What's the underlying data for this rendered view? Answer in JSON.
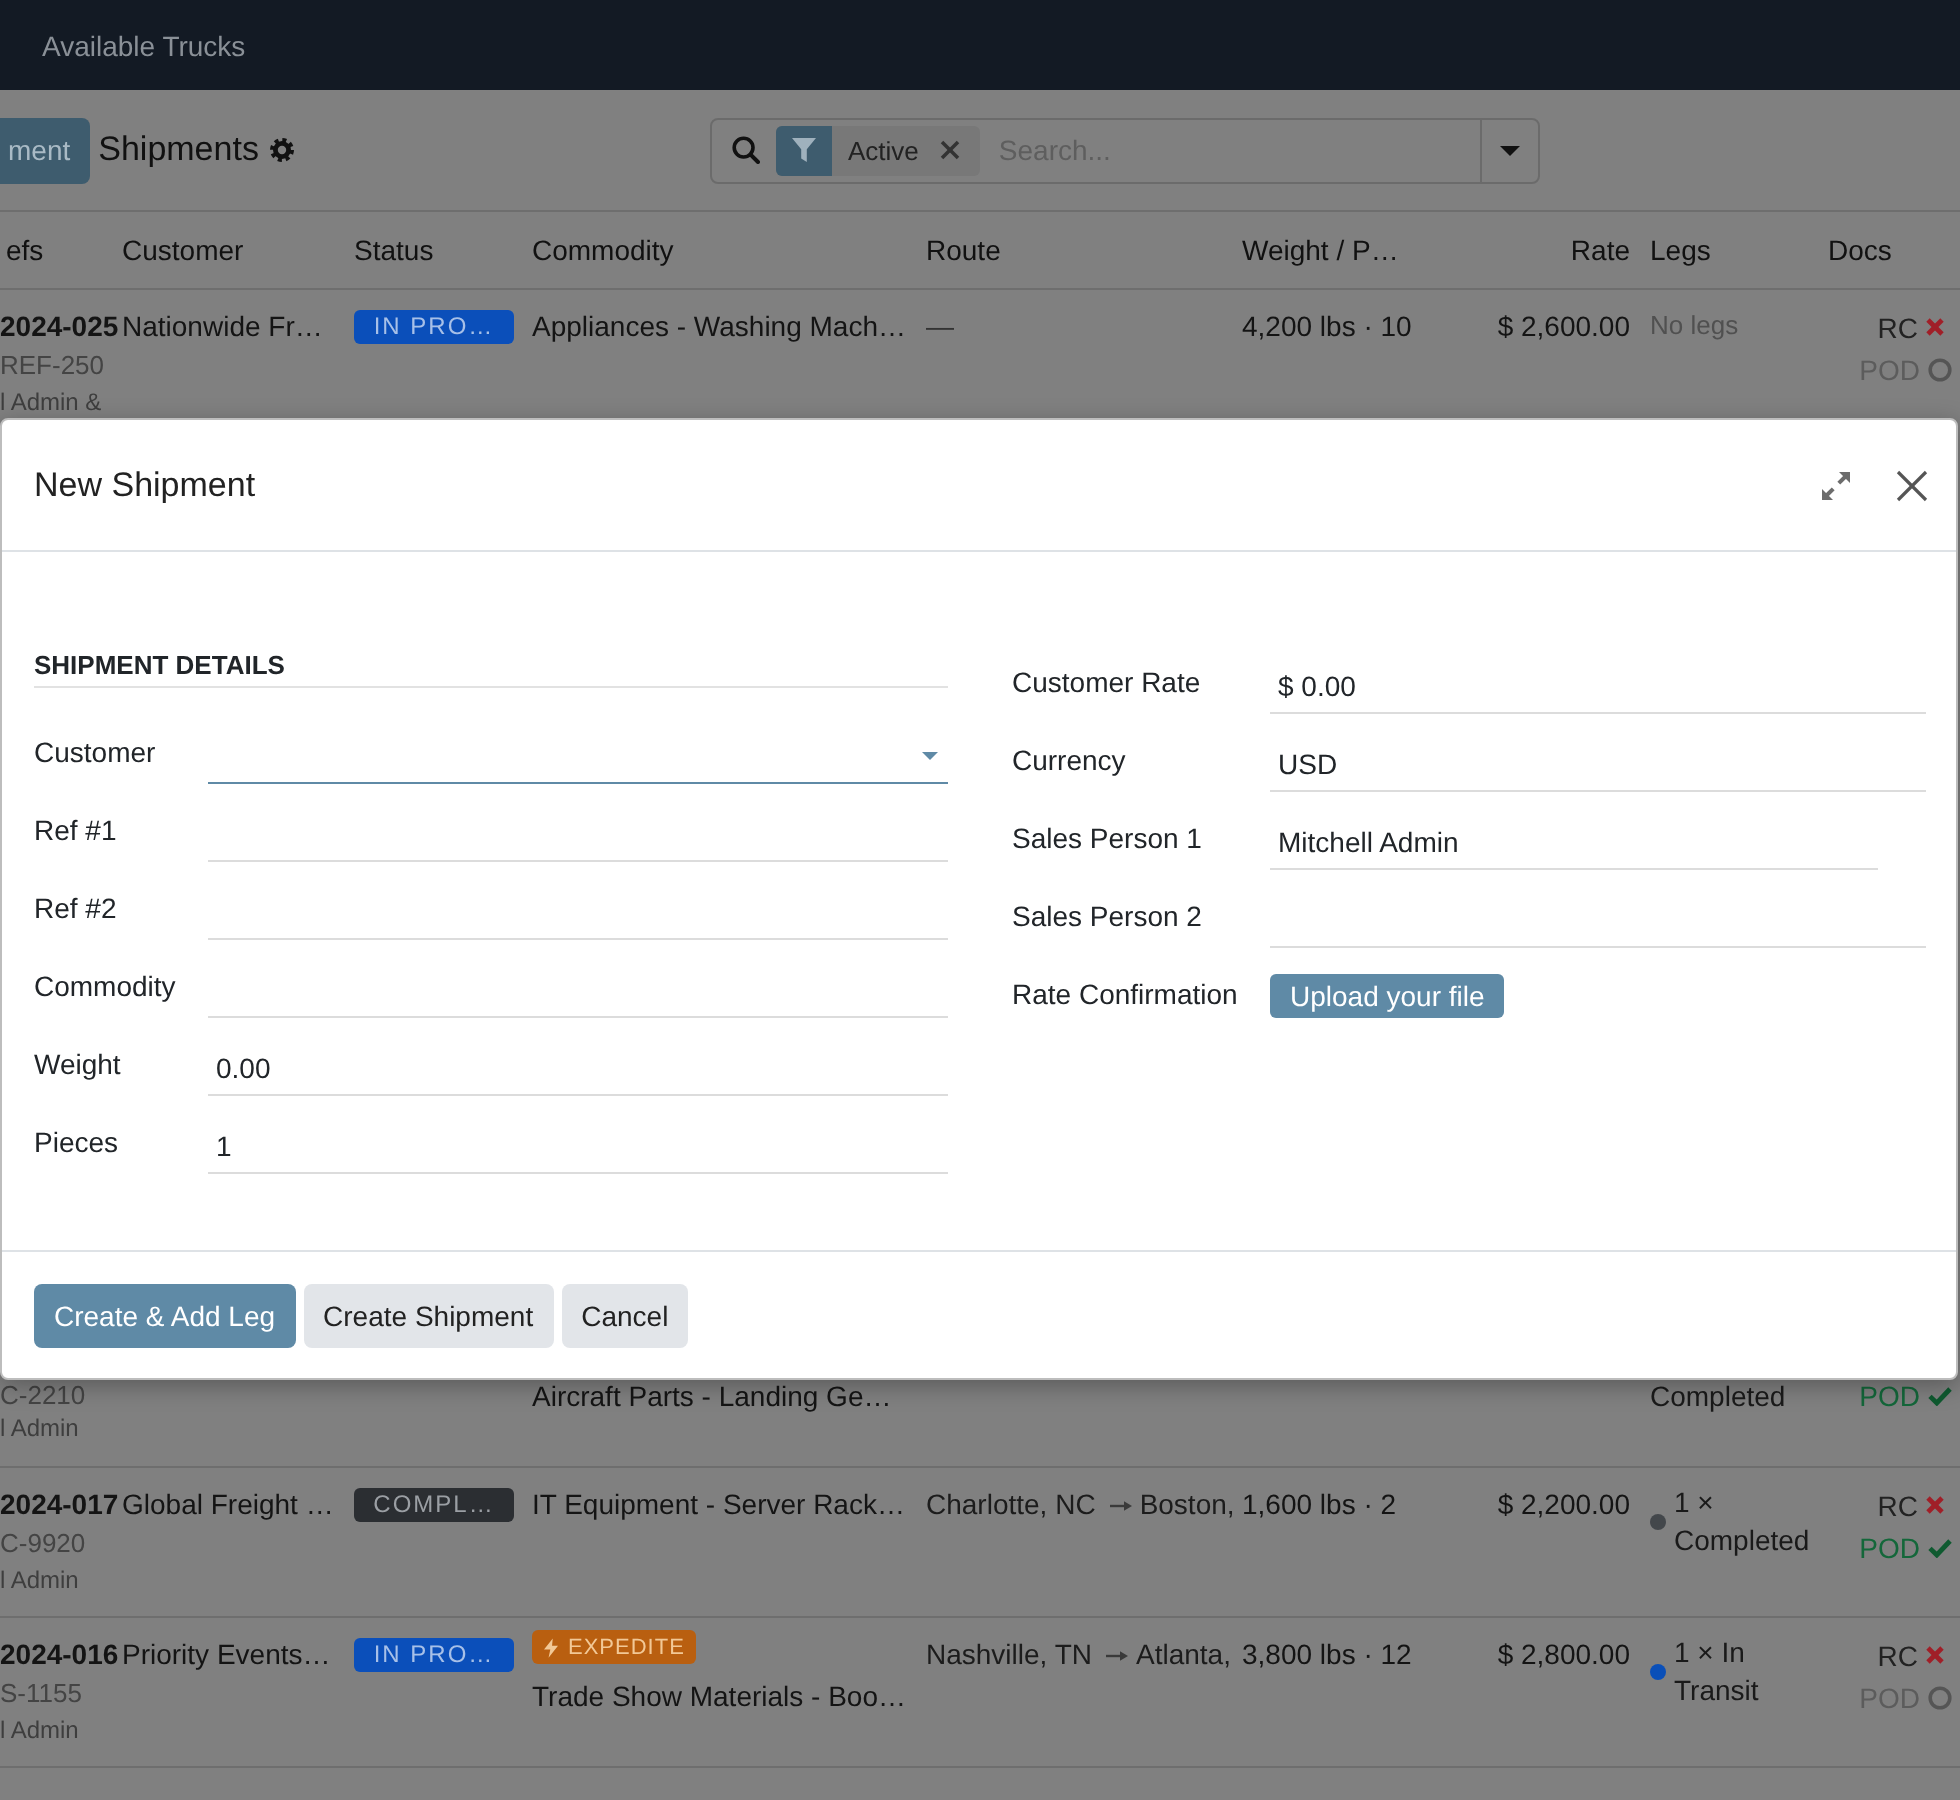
{
  "navbar": {
    "items": [
      {
        "label": "Available Trucks"
      }
    ]
  },
  "control_panel": {
    "button": "ment",
    "title": "Shipments"
  },
  "search": {
    "facets": [
      {
        "label": "Active"
      }
    ],
    "placeholder": "Search..."
  },
  "table": {
    "columns": [
      {
        "label": "efs",
        "kind": "text"
      },
      {
        "label": "Customer",
        "kind": "text"
      },
      {
        "label": "Status",
        "kind": "text"
      },
      {
        "label": "Commodity",
        "kind": "text"
      },
      {
        "label": "Route",
        "kind": "text"
      },
      {
        "label": "Weight / P…",
        "kind": "text"
      },
      {
        "label": "Rate",
        "kind": "number"
      },
      {
        "label": "Legs",
        "kind": "text"
      },
      {
        "label": "Docs",
        "kind": "text"
      }
    ],
    "rows_above_dialog": [
      {
        "kind": "full",
        "number": "2024-025",
        "reference": "REF-250",
        "salesperson": "l Admin &",
        "customer": "Nationwide Fr…",
        "status": {
          "label": "IN PRO…",
          "kind": "in_progress"
        },
        "commodity": "Appliances - Washing Mach…",
        "route_placeholder": "—",
        "weight": "4,200 lbs · 10",
        "rate": "$ 2,600.00",
        "legs": {
          "text": "No legs",
          "kind": "none"
        },
        "docs": [
          {
            "label": "RC",
            "kind": "missing"
          },
          {
            "label": "POD",
            "kind": "pending"
          }
        ]
      }
    ],
    "rows_below_dialog": [
      {
        "kind": "clipped",
        "reference": "C-2210",
        "salesperson": "l Admin",
        "commodity": "Aircraft Parts - Landing Ge…",
        "legs": {
          "text": "Completed",
          "kind": "summary"
        },
        "docs": [
          {
            "label": "POD",
            "kind": "done"
          }
        ]
      },
      {
        "kind": "full",
        "number": "2024-017",
        "reference": "C-9920",
        "salesperson": "l Admin",
        "customer": "Global Freight …",
        "status": {
          "label": "COMPL…",
          "kind": "completed"
        },
        "commodity": "IT Equipment - Server Rack…",
        "route": {
          "origin": "Charlotte, NC",
          "destination": "Boston,"
        },
        "weight": "1,600 lbs · 2",
        "rate": "$ 2,200.00",
        "legs": {
          "text": "1 × Completed",
          "kind": "summary",
          "color": "#43474b"
        },
        "docs": [
          {
            "label": "RC",
            "kind": "missing"
          },
          {
            "label": "POD",
            "kind": "done"
          }
        ]
      },
      {
        "kind": "full",
        "number": "2024-016",
        "reference": "S-1155",
        "salesperson": "l Admin",
        "customer": "Priority Events…",
        "status": {
          "label": "IN PRO…",
          "kind": "in_progress"
        },
        "tag": {
          "label": "EXPEDITE",
          "kind": "expedite"
        },
        "commodity": "Trade Show Materials - Boo…",
        "route": {
          "origin": "Nashville, TN",
          "destination": "Atlanta,"
        },
        "weight": "3,800 lbs · 12",
        "rate": "$ 2,800.00",
        "legs": {
          "text": "1 × In Transit",
          "kind": "summary",
          "color": "#0a4fb8"
        },
        "docs": [
          {
            "label": "RC",
            "kind": "missing"
          },
          {
            "label": "POD",
            "kind": "pending"
          }
        ]
      }
    ]
  },
  "dialog": {
    "title": "New Shipment",
    "section_title": "SHIPMENT DETAILS",
    "left_fields": [
      {
        "label": "Customer",
        "kind": "select",
        "focused": true
      },
      {
        "label": "Ref #1",
        "kind": "text",
        "focused": false
      },
      {
        "label": "Ref #2",
        "kind": "text",
        "focused": false
      },
      {
        "label": "Commodity",
        "kind": "text",
        "focused": false
      },
      {
        "label": "Weight",
        "kind": "text",
        "value": "0.00",
        "focused": false
      },
      {
        "label": "Pieces",
        "kind": "text",
        "value": "1",
        "focused": false
      }
    ],
    "right_fields": [
      {
        "label": "Customer Rate",
        "kind": "text",
        "value": "$ 0.00",
        "focused": false
      },
      {
        "label": "Currency",
        "kind": "text",
        "value": "USD",
        "focused": false
      },
      {
        "label": "Sales Person 1",
        "kind": "relation",
        "value": "Mitchell Admin",
        "focused": false
      },
      {
        "label": "Sales Person 2",
        "kind": "relation",
        "focused": false
      },
      {
        "label": "Rate Confirmation",
        "kind": "upload",
        "button": "Upload your file"
      }
    ],
    "buttons": [
      {
        "label": "Create & Add Leg",
        "kind": "primary"
      },
      {
        "label": "Create Shipment",
        "kind": "secondary"
      },
      {
        "label": "Cancel",
        "kind": "secondary"
      }
    ]
  }
}
